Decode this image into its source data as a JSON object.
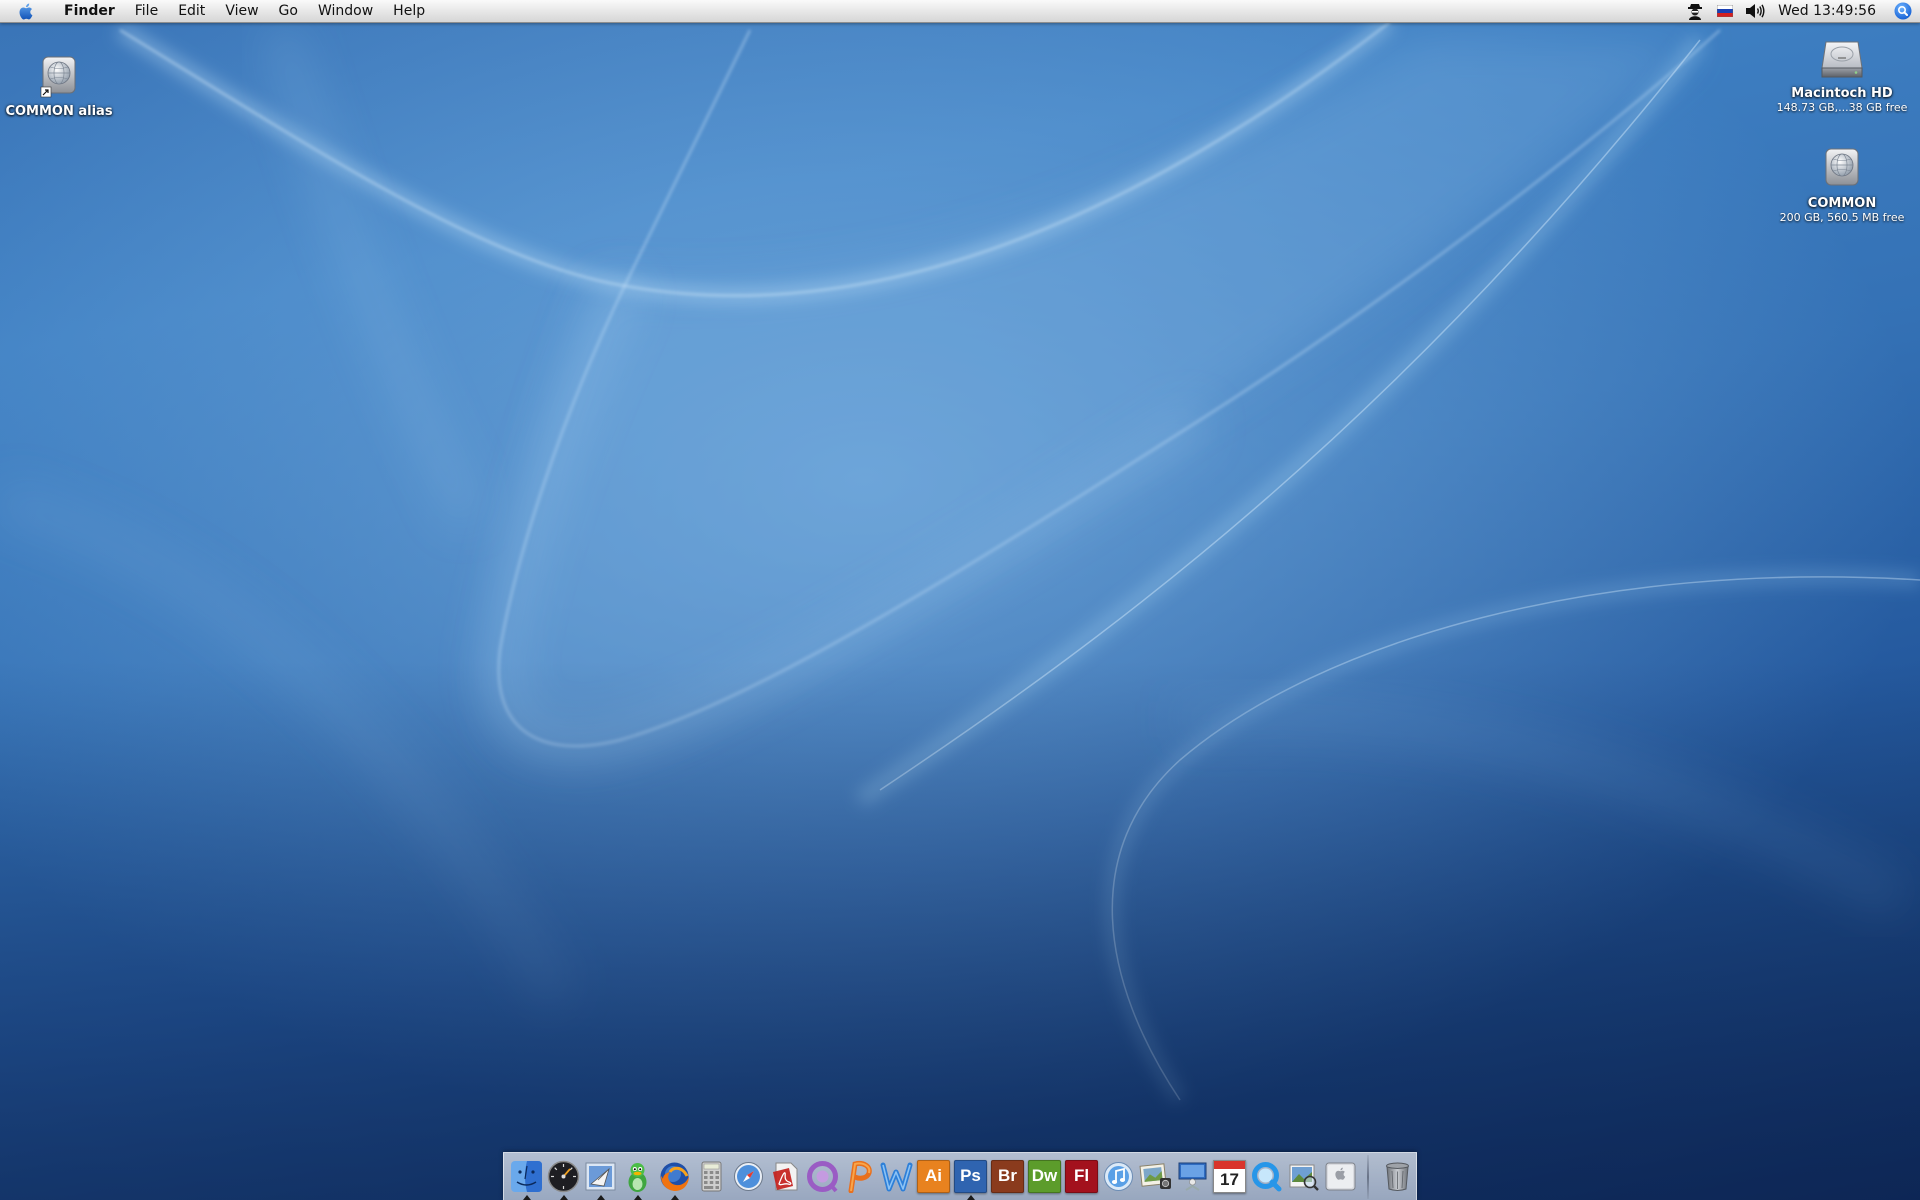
{
  "menubar": {
    "apple_icon": "apple-logo-icon",
    "app_name": "Finder",
    "menus": [
      "File",
      "Edit",
      "View",
      "Go",
      "Window",
      "Help"
    ],
    "status_icons": [
      "spy-agent-icon",
      "russian-flag-icon",
      "volume-icon"
    ],
    "clock": "Wed 13:49:56",
    "spotlight_icon": "spotlight-search-icon"
  },
  "desktop": {
    "icons": [
      {
        "label": "COMMON alias",
        "info": "",
        "icon": "network-volume-alias-icon"
      },
      {
        "label": "Macintoch HD",
        "info": "148.73 GB,...38 GB free",
        "icon": "hard-drive-icon"
      },
      {
        "label": "COMMON",
        "info": "200 GB, 560.5 MB free",
        "icon": "network-volume-icon"
      }
    ]
  },
  "dock": {
    "items": [
      {
        "icon": "finder-icon",
        "running": true
      },
      {
        "icon": "dashboard-icon",
        "running": true
      },
      {
        "icon": "mail-icon",
        "running": true
      },
      {
        "icon": "adium-duck-icon",
        "running": true
      },
      {
        "icon": "firefox-icon",
        "running": true
      },
      {
        "icon": "calculator-icon",
        "running": false
      },
      {
        "icon": "safari-icon",
        "running": false
      },
      {
        "icon": "acrobat-icon",
        "running": false
      },
      {
        "icon": "omniweb-icon",
        "running": false
      },
      {
        "icon": "powerpoint-icon",
        "running": false
      },
      {
        "icon": "word-icon",
        "running": false
      },
      {
        "label": "Ai",
        "icon": "illustrator-icon",
        "color": "#e8821f",
        "running": false
      },
      {
        "label": "Ps",
        "icon": "photoshop-icon",
        "color": "#2f64b0",
        "running": true
      },
      {
        "label": "Br",
        "icon": "bridge-icon",
        "color": "#8a3b1d",
        "running": false
      },
      {
        "label": "Dw",
        "icon": "dreamweaver-icon",
        "color": "#5c9c2b",
        "running": false
      },
      {
        "label": "Fl",
        "icon": "flash-icon",
        "color": "#a3111d",
        "running": false
      },
      {
        "icon": "itunes-icon",
        "running": false
      },
      {
        "icon": "iphoto-icon",
        "running": false
      },
      {
        "icon": "keynote-icon",
        "running": false
      },
      {
        "label": "17",
        "icon": "ical-icon",
        "running": false
      },
      {
        "icon": "quicktime-icon",
        "running": false
      },
      {
        "icon": "preview-icon",
        "running": false
      },
      {
        "icon": "system-preferences-icon",
        "running": false
      }
    ],
    "trash_icon": "trash-icon"
  }
}
